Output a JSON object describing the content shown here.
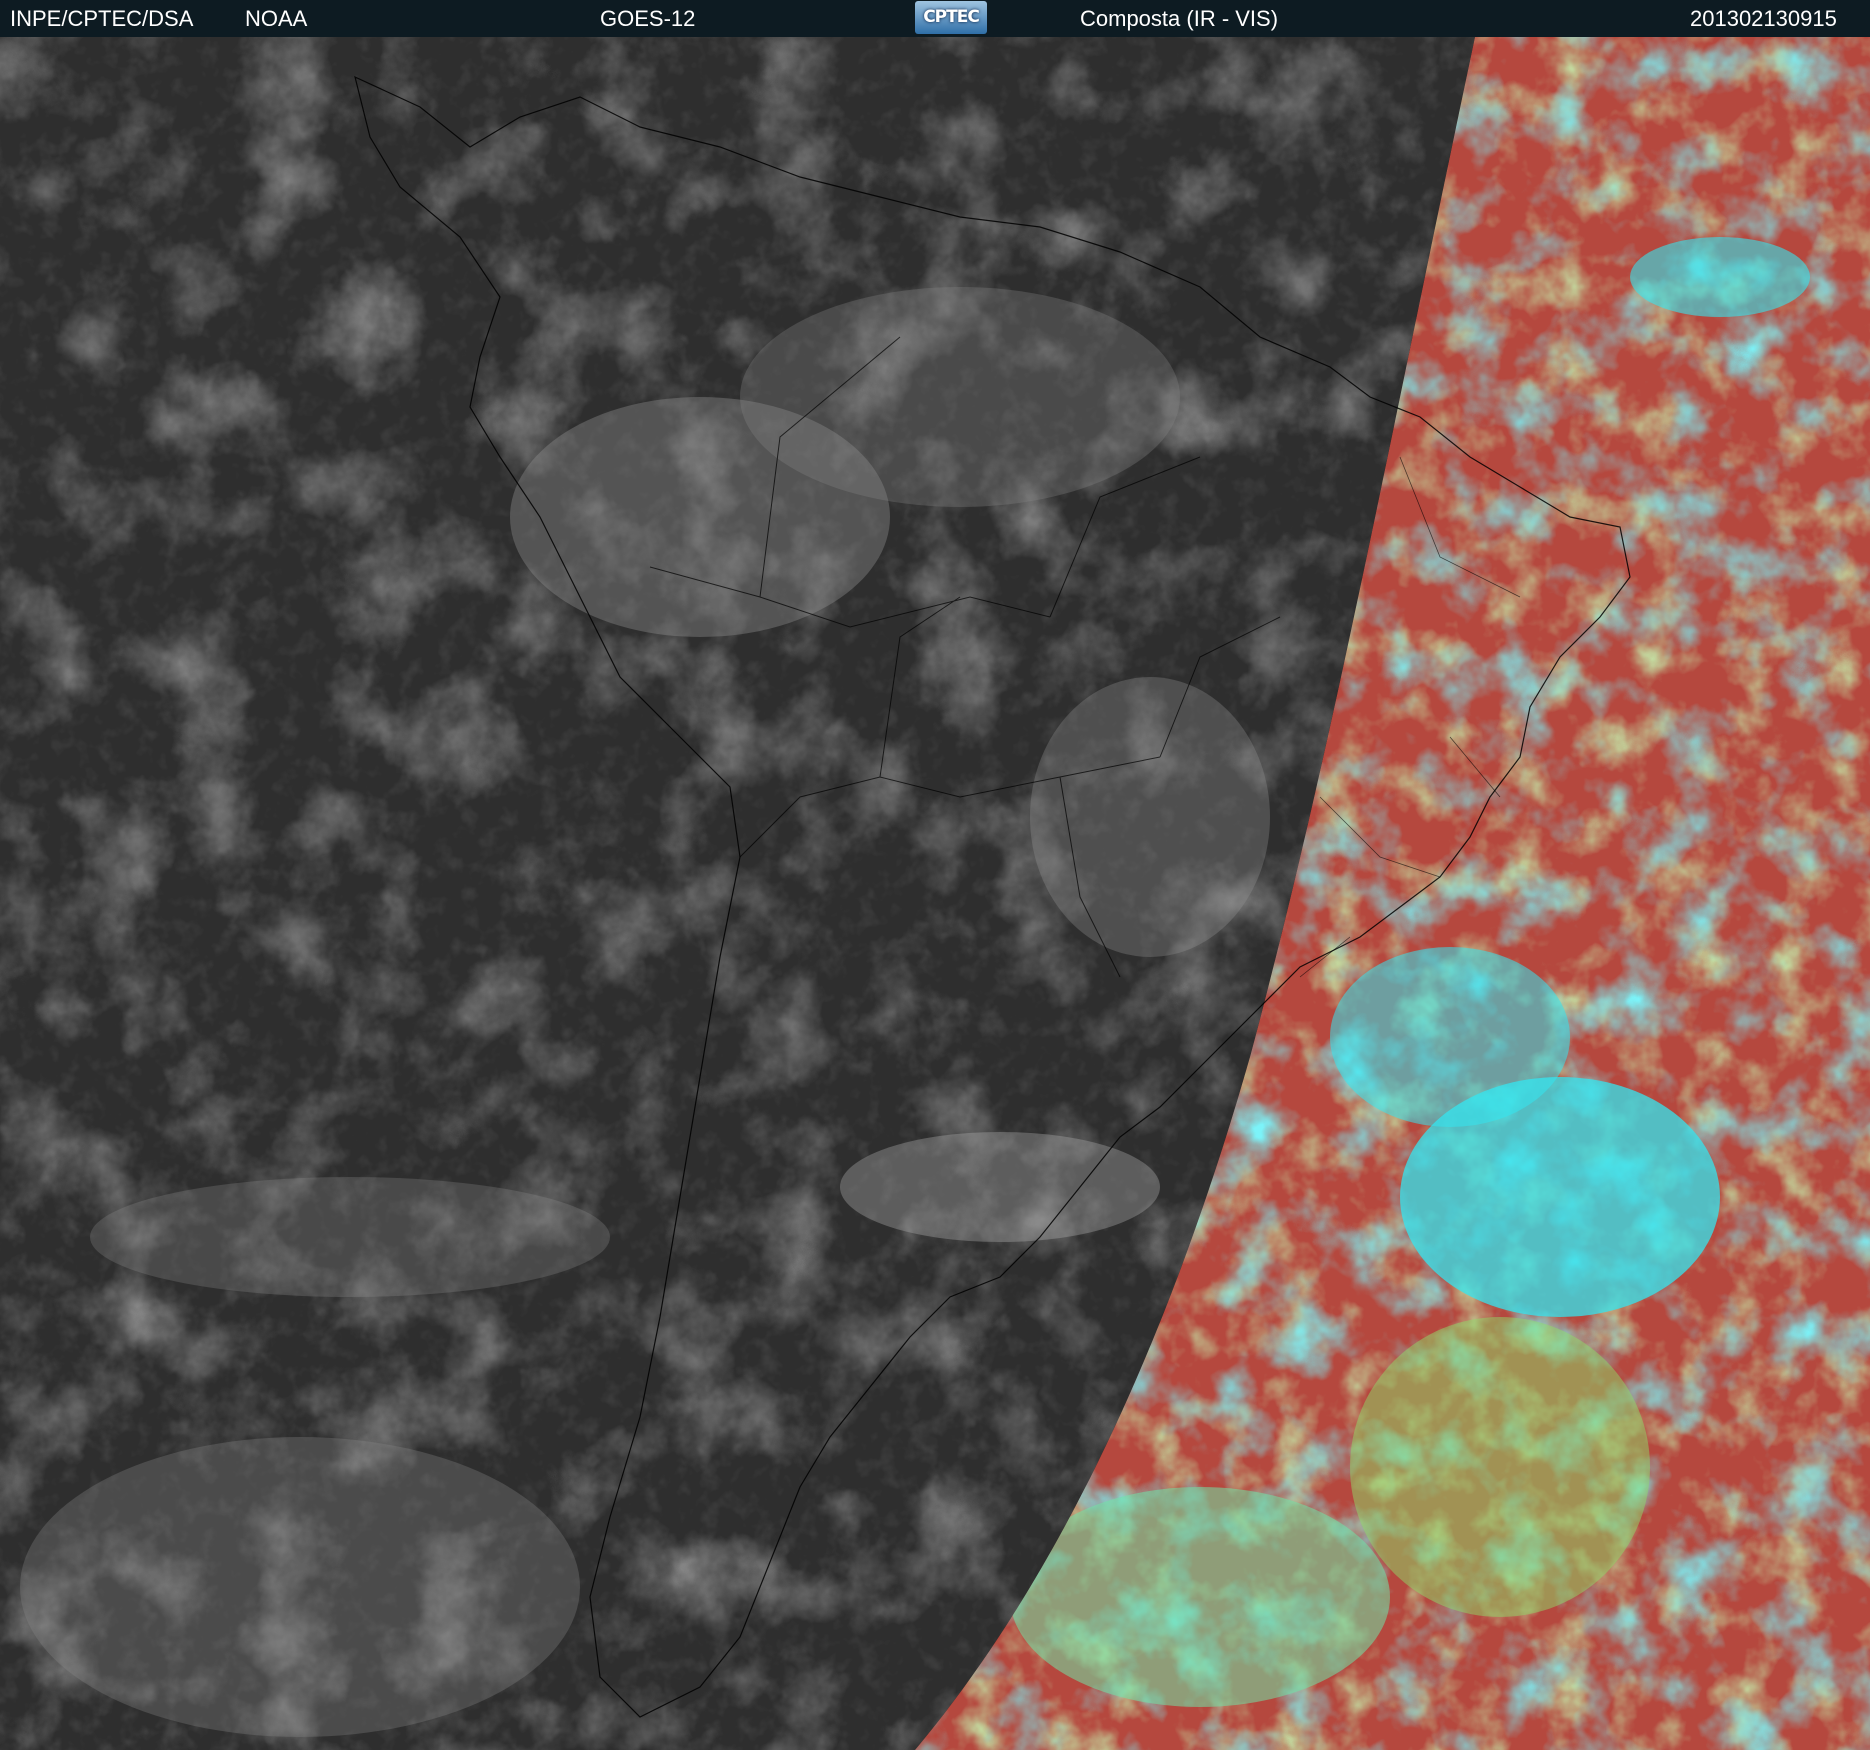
{
  "header": {
    "agency": "INPE/CPTEC/DSA",
    "partner": "NOAA",
    "satellite": "GOES-12",
    "logo_text": "CPTEC",
    "product": "Composta (IR - VIS)",
    "timestamp": "201302130915"
  },
  "colors": {
    "header_bg": "#0d1b22",
    "ir_background": "#2e2e2e",
    "vis_land_ocean": "#b5483e",
    "vis_cloud_cyan": "#33e6f0",
    "vis_cloud_green": "#8edc6a",
    "boundary_lines": "#000000"
  }
}
